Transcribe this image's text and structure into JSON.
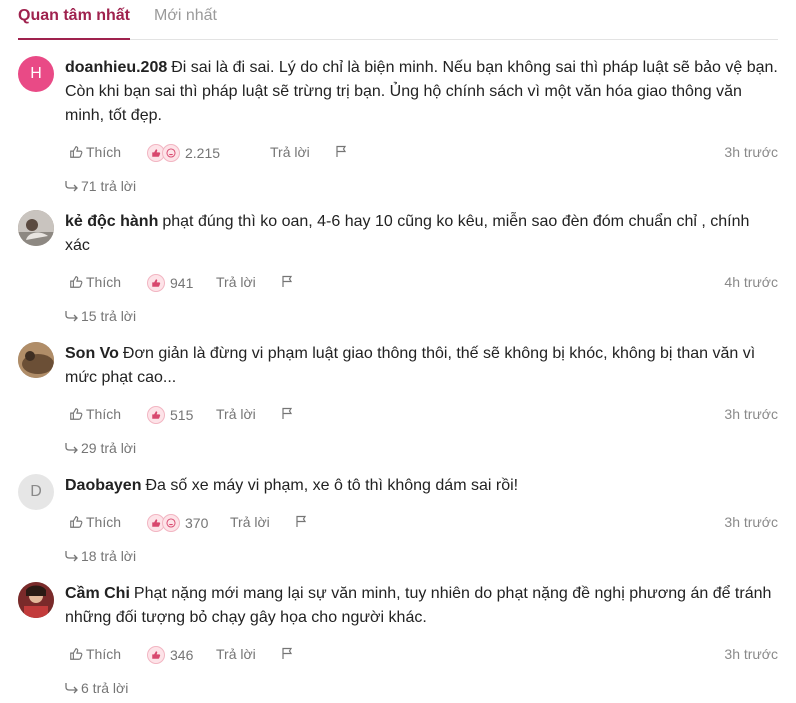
{
  "tabs": {
    "active": "Quan tâm nhất",
    "inactive": "Mới nhất"
  },
  "labels": {
    "like": "Thích",
    "reply": "Trả lời"
  },
  "colors": {
    "accent": "#9f224e",
    "avatar_h": "#e94a86",
    "avatar_d": "#e6e6e6"
  },
  "comments": [
    {
      "author": "doanhieu.208",
      "avatar_letter": "H",
      "text": "Đi sai là đi sai. Lý do chỉ là biện minh. Nếu bạn không sai thì pháp luật sẽ bảo vệ bạn. Còn khi bạn sai thì pháp luật sẽ trừng trị bạn. Ủng hộ chính sách vì một văn hóa giao thông văn minh, tốt đẹp.",
      "reactions": "2.215",
      "time": "3h trước",
      "replies": "71 trả lời"
    },
    {
      "author": "kẻ độc hành",
      "text": "phạt đúng thì ko oan, 4-6 hay 10 cũng ko kêu, miễn sao đèn đóm chuẩn chỉ , chính xác",
      "reactions": "941",
      "time": "4h trước",
      "replies": "15 trả lời"
    },
    {
      "author": "Son Vo",
      "text": "Đơn giản là đừng vi phạm luật giao thông thôi, thế sẽ không bị khóc, không bị than văn vì mức phạt cao...",
      "reactions": "515",
      "time": "3h trước",
      "replies": "29 trả lời"
    },
    {
      "author": "Daobayen",
      "avatar_letter": "D",
      "text": "Đa số xe máy vi phạm, xe ô tô thì không dám sai rồi!",
      "reactions": "370",
      "time": "3h trước",
      "replies": "18 trả lời"
    },
    {
      "author": "Cầm Chi",
      "text": "Phạt nặng mới mang lại sự văn minh, tuy nhiên do phạt nặng đề nghị phương án để tránh những đối tượng bỏ chạy gây họa cho người khác.",
      "reactions": "346",
      "time": "3h trước",
      "replies": "6 trả lời"
    }
  ]
}
